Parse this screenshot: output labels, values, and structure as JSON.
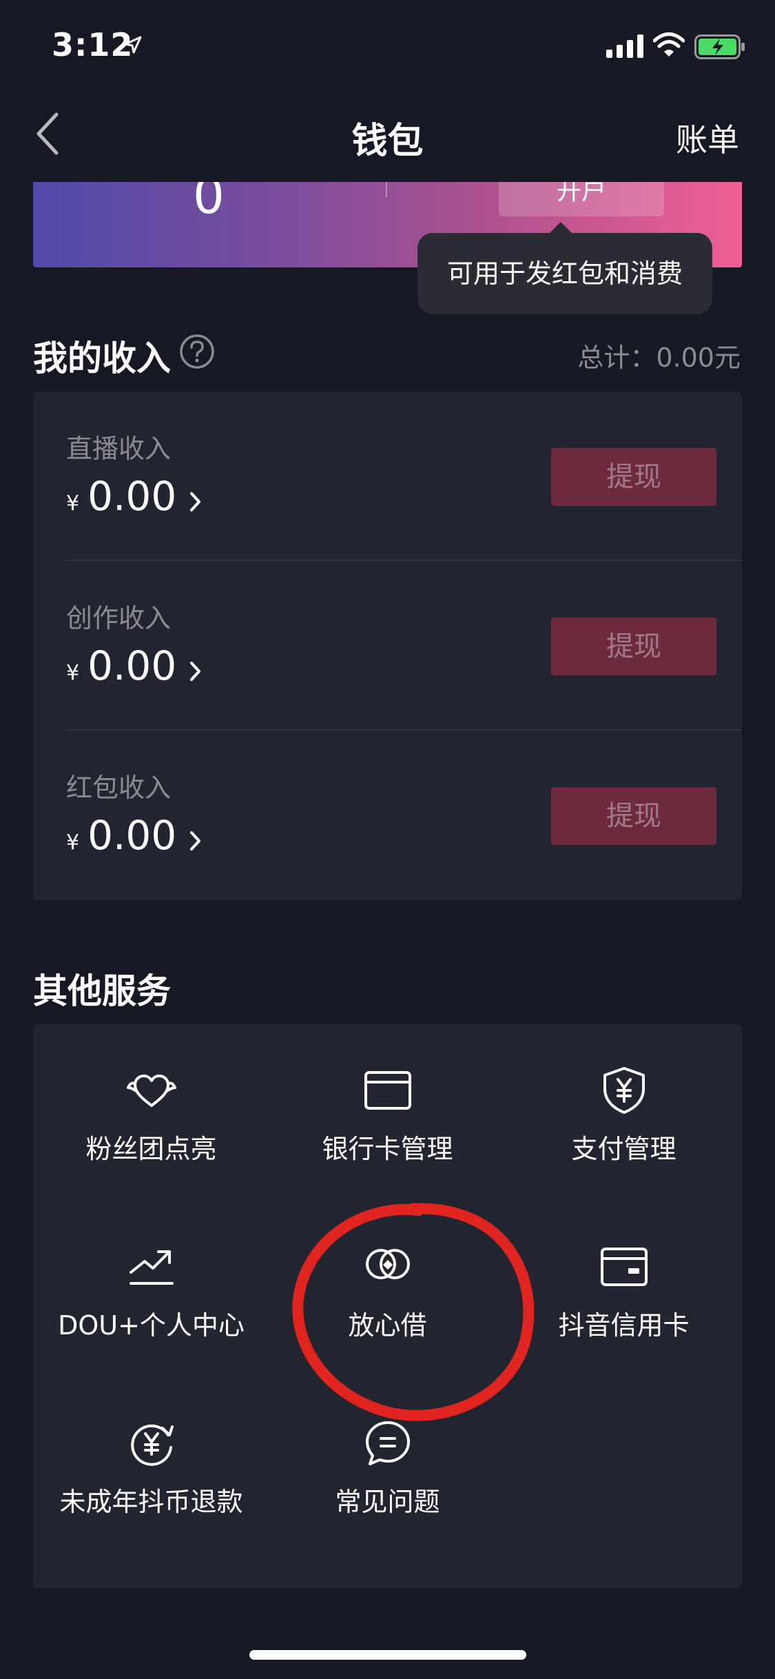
{
  "status_bar": {
    "time": "3:12"
  },
  "nav": {
    "title": "钱包",
    "bill_label": "账单"
  },
  "balance": {
    "value": "0",
    "open_account_label": "开户",
    "tooltip": "可用于发红包和消费"
  },
  "income": {
    "title": "我的收入",
    "total": "总计：0.00元",
    "currency_symbol": "¥",
    "withdraw_label": "提现",
    "rows": [
      {
        "label": "直播收入",
        "amount": "0.00"
      },
      {
        "label": "创作收入",
        "amount": "0.00"
      },
      {
        "label": "红包收入",
        "amount": "0.00"
      }
    ]
  },
  "services": {
    "title": "其他服务",
    "items": [
      {
        "label": "粉丝团点亮",
        "icon": "fan-heart-icon"
      },
      {
        "label": "银行卡管理",
        "icon": "bank-card-icon"
      },
      {
        "label": "支付管理",
        "icon": "yen-shield-icon"
      },
      {
        "label": "DOU+个人中心",
        "icon": "trend-up-icon"
      },
      {
        "label": "放心借",
        "icon": "loan-heart-icon"
      },
      {
        "label": "抖音信用卡",
        "icon": "credit-card-icon"
      },
      {
        "label": "未成年抖币退款",
        "icon": "yen-refund-icon"
      },
      {
        "label": "常见问题",
        "icon": "faq-chat-icon"
      }
    ]
  },
  "colors": {
    "background": "#161823",
    "card": "#222530",
    "withdraw_button": "#6e2a3d",
    "annotation": "#e0241f"
  }
}
